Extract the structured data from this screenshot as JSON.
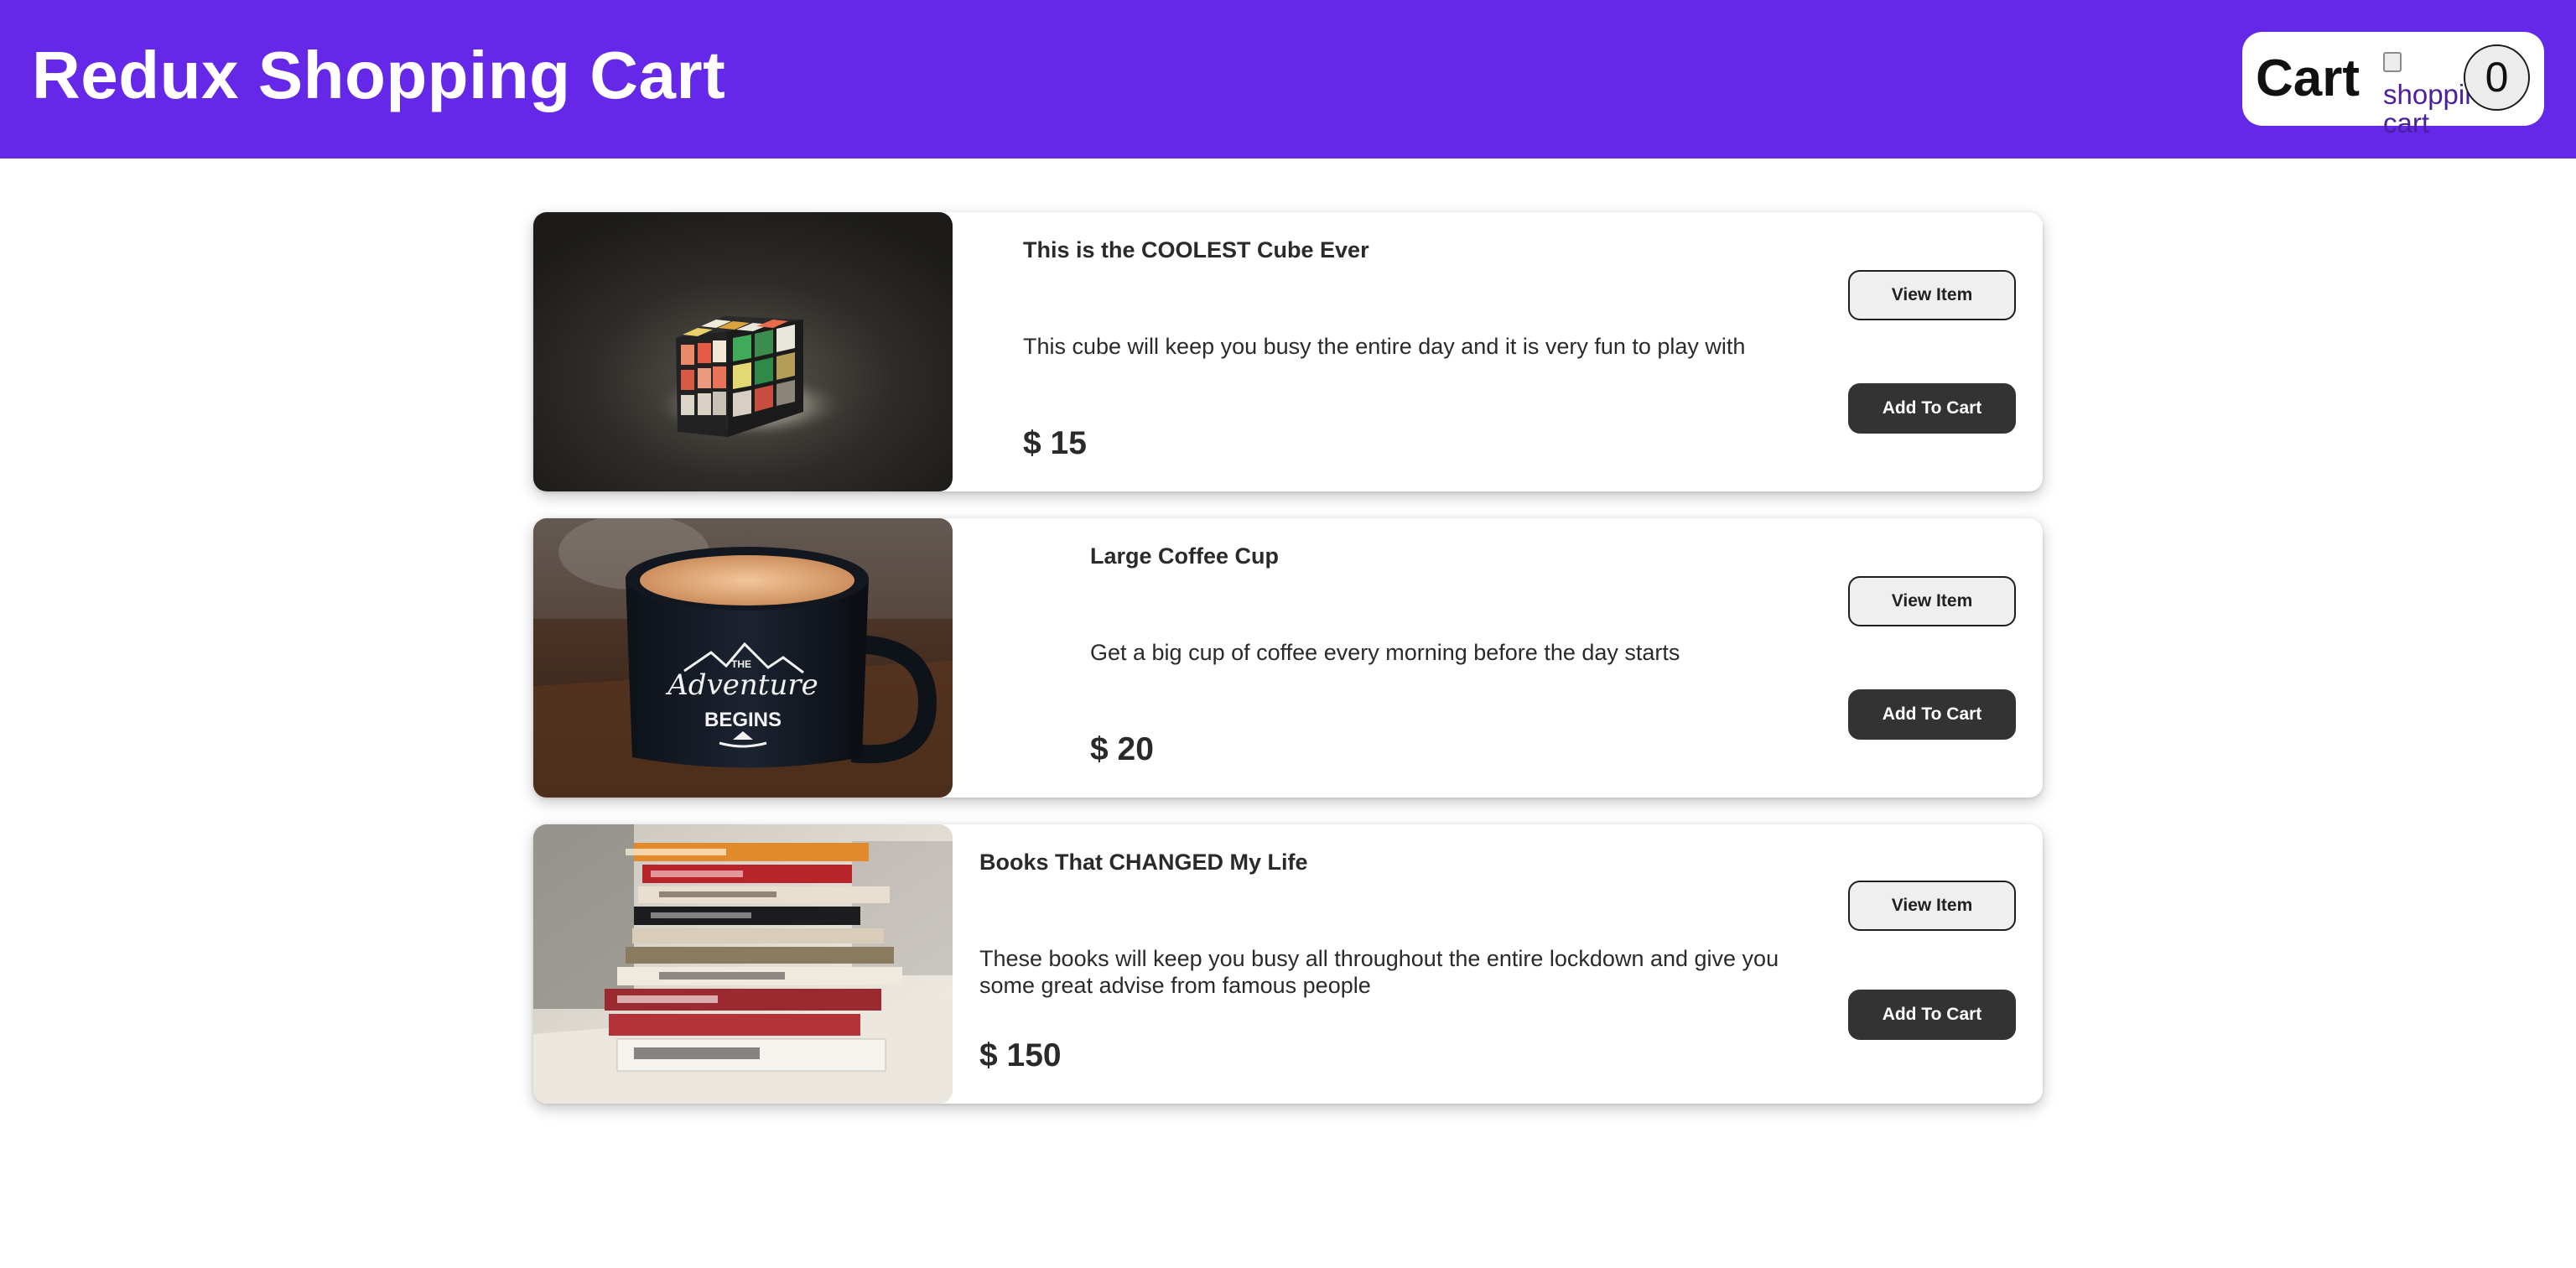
{
  "header": {
    "title": "Redux Shopping Cart",
    "cart_label": "Cart",
    "cart_image_alt": "shopping cart",
    "cart_count": "0"
  },
  "colors": {
    "navbar": "#6528e9",
    "primary_button": "#333333",
    "secondary_button": "#efefef"
  },
  "products": [
    {
      "title": "This is the COOLEST Cube Ever",
      "description": "This cube will keep you busy the entire day and it is very fun to play with",
      "price": "$ 15",
      "image": "rubiks-cube-photo",
      "view_label": "View Item",
      "add_label": "Add To Cart"
    },
    {
      "title": "Large Coffee Cup",
      "description": "Get a big cup of coffee every morning before the day starts",
      "price": "$ 20",
      "image": "coffee-mug-photo",
      "image_text": [
        "THE",
        "Adventure",
        "BEGINS"
      ],
      "view_label": "View Item",
      "add_label": "Add To Cart"
    },
    {
      "title": "Books That CHANGED My Life",
      "description": "These books will keep you busy all throughout the entire lockdown and give you some great advise from famous people",
      "price": "$ 150",
      "image": "book-stack-photo",
      "view_label": "View Item",
      "add_label": "Add To Cart"
    }
  ]
}
